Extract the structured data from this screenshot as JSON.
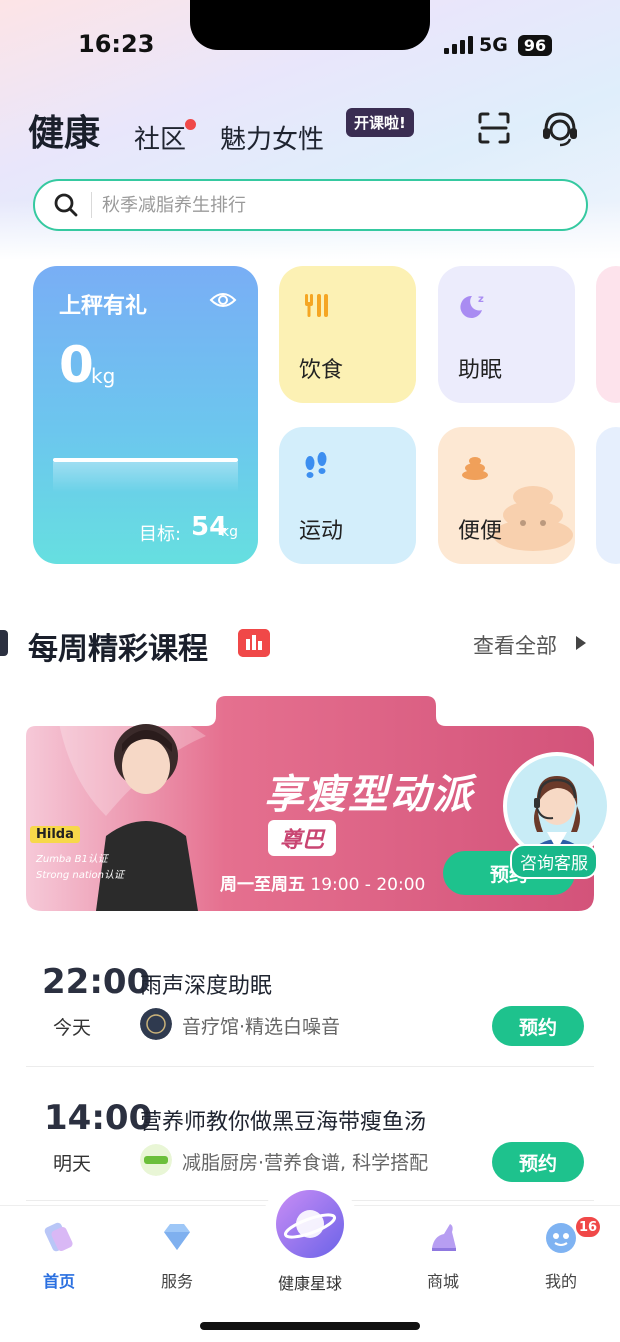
{
  "status": {
    "time": "16:23",
    "network": "5G",
    "battery": "96"
  },
  "topnav": {
    "main": "健康",
    "community": "社区",
    "charm": "魅力女性",
    "course_badge": "开课啦!"
  },
  "search": {
    "placeholder": "秋季减脂养生排行"
  },
  "weigh": {
    "title": "上秤有礼",
    "value": "0",
    "unit": "kg",
    "target_label": "目标:",
    "target_value": "54",
    "target_unit": "kg"
  },
  "tiles": {
    "food": "饮食",
    "sleep": "助眠",
    "sport": "运动",
    "poop": "便便"
  },
  "section": {
    "title": "每周精彩课程",
    "view_all": "查看全部"
  },
  "banner": {
    "title": "享瘦型动派",
    "subtitle": "尊巴",
    "days": "周一至周五",
    "hours": "19:00 - 20:00",
    "book": "预约",
    "instructor_name": "Hilda",
    "cert1": "Zumba B1认证",
    "cert2": "Strong nation认证"
  },
  "consult": {
    "label": "咨询客服"
  },
  "schedule": [
    {
      "time": "22:00",
      "day": "今天",
      "title": "雨声深度助眠",
      "sub": "音疗馆·精选白噪音",
      "book": "预约"
    },
    {
      "time": "14:00",
      "day": "明天",
      "title": "营养师教你做黑豆海带瘦鱼汤",
      "sub": "减脂厨房·营养食谱, 科学搭配",
      "book": "预约"
    }
  ],
  "tabbar": {
    "home": "首页",
    "service": "服务",
    "planet": "健康星球",
    "mall": "商城",
    "mine": "我的",
    "mine_badge": "16"
  },
  "colors": {
    "accent": "#1ec28d",
    "active_tab": "#2a6fe0",
    "alert": "#f04848"
  }
}
